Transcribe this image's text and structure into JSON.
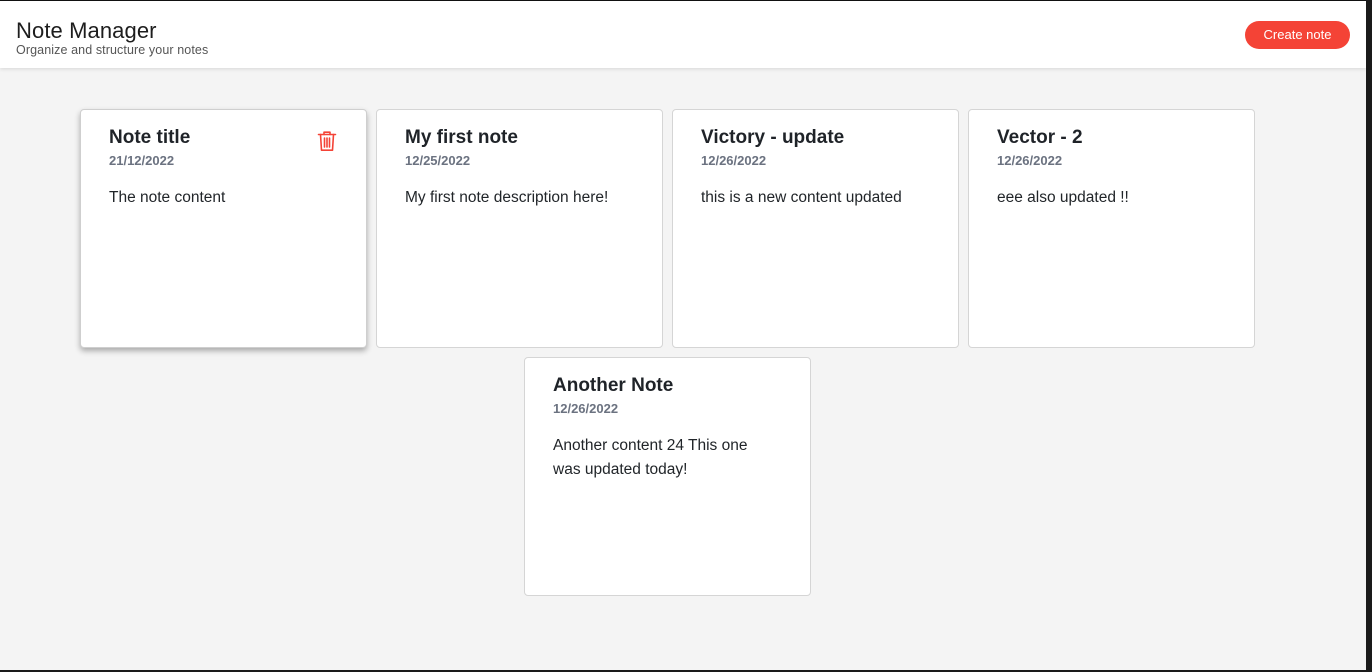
{
  "header": {
    "title": "Note Manager",
    "subtitle": "Organize and structure your notes",
    "create_button_label": "Create note"
  },
  "notes": [
    {
      "title": "Note title",
      "date": "21/12/2022",
      "content": "The note content",
      "shows_delete_icon": true
    },
    {
      "title": "My first note",
      "date": "12/25/2022",
      "content": "My first note description here!"
    },
    {
      "title": "Victory - update",
      "date": "12/26/2022",
      "content": "this is a new content updated"
    },
    {
      "title": "Vector - 2",
      "date": "12/26/2022",
      "content": "eee also updated !!"
    },
    {
      "title": "Another Note",
      "date": "12/26/2022",
      "content": "Another content 24 This one was updated today!"
    }
  ],
  "colors": {
    "accent": "#f44336",
    "background": "#f4f4f4",
    "card": "#ffffff"
  },
  "icons": {
    "delete": "trash-icon"
  }
}
